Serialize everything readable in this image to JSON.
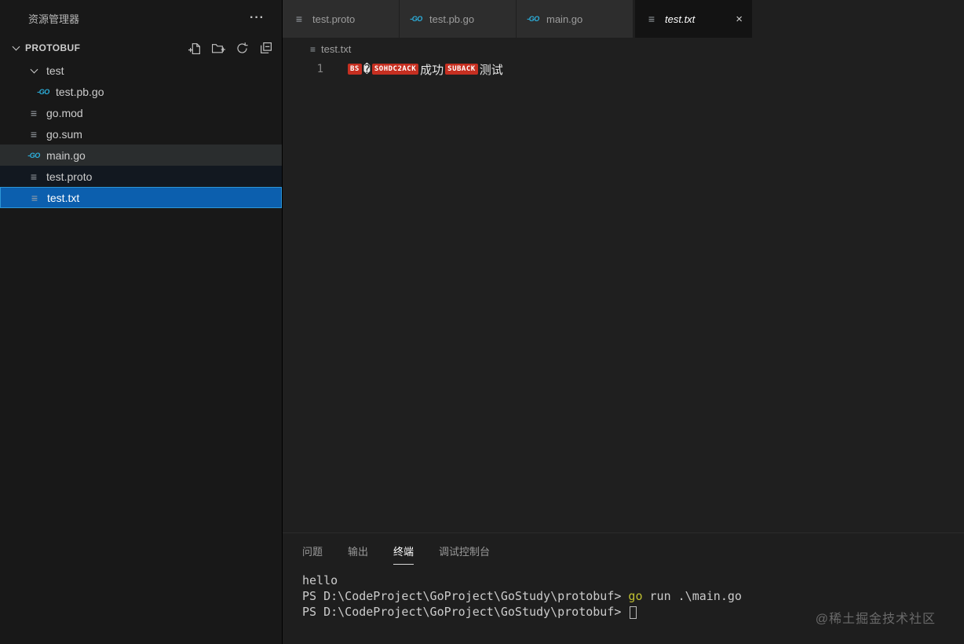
{
  "sidebar": {
    "title": "资源管理器",
    "section": {
      "label": "PROTOBUF"
    },
    "tree": [
      {
        "label": "test",
        "type": "folder",
        "expanded": true
      },
      {
        "label": "test.pb.go",
        "type": "go",
        "level": 1
      },
      {
        "label": "go.mod",
        "type": "file"
      },
      {
        "label": "go.sum",
        "type": "file"
      },
      {
        "label": "main.go",
        "type": "go",
        "state": "active"
      },
      {
        "label": "test.proto",
        "type": "file"
      },
      {
        "label": "test.txt",
        "type": "file",
        "state": "selected"
      }
    ]
  },
  "tabs": [
    {
      "label": "test.proto",
      "icon": "file"
    },
    {
      "label": "test.pb.go",
      "icon": "go"
    },
    {
      "label": "main.go",
      "icon": "go"
    },
    {
      "label": "test.txt",
      "icon": "file",
      "active": true,
      "dirty_preview_italic": true
    }
  ],
  "breadcrumb": {
    "file": "test.txt"
  },
  "editor": {
    "line_number": "1",
    "segments": [
      "BS",
      "�",
      "SOHDC2ACK",
      "成功",
      "SUBACK",
      "测试"
    ]
  },
  "panel": {
    "tabs": [
      {
        "label": "问题"
      },
      {
        "label": "输出"
      },
      {
        "label": "终端",
        "active": true
      },
      {
        "label": "调试控制台"
      }
    ],
    "terminal": {
      "line1": "hello",
      "prompt": "PS D:\\CodeProject\\GoProject\\GoStudy\\protobuf> ",
      "command": "go",
      "command_args": " run .\\main.go"
    }
  },
  "watermark": "@稀土掘金技术社区",
  "icons": {
    "more": "···",
    "go": "-GO",
    "file": "≡",
    "close": "×"
  },
  "colors": {
    "selection_blue": "#0c5fae",
    "selection_border": "#2d96d6",
    "hover_gray": "#2a2d2e",
    "badge_red": "#c62f21",
    "go_icon_cyan": "#2cb2e0",
    "command_yellow": "#c0c031",
    "tab_active_bg": "#131313",
    "tab_inactive_bg": "#2d2d2d",
    "sidebar_bg": "#181818",
    "editor_bg": "#1f1f1f"
  }
}
